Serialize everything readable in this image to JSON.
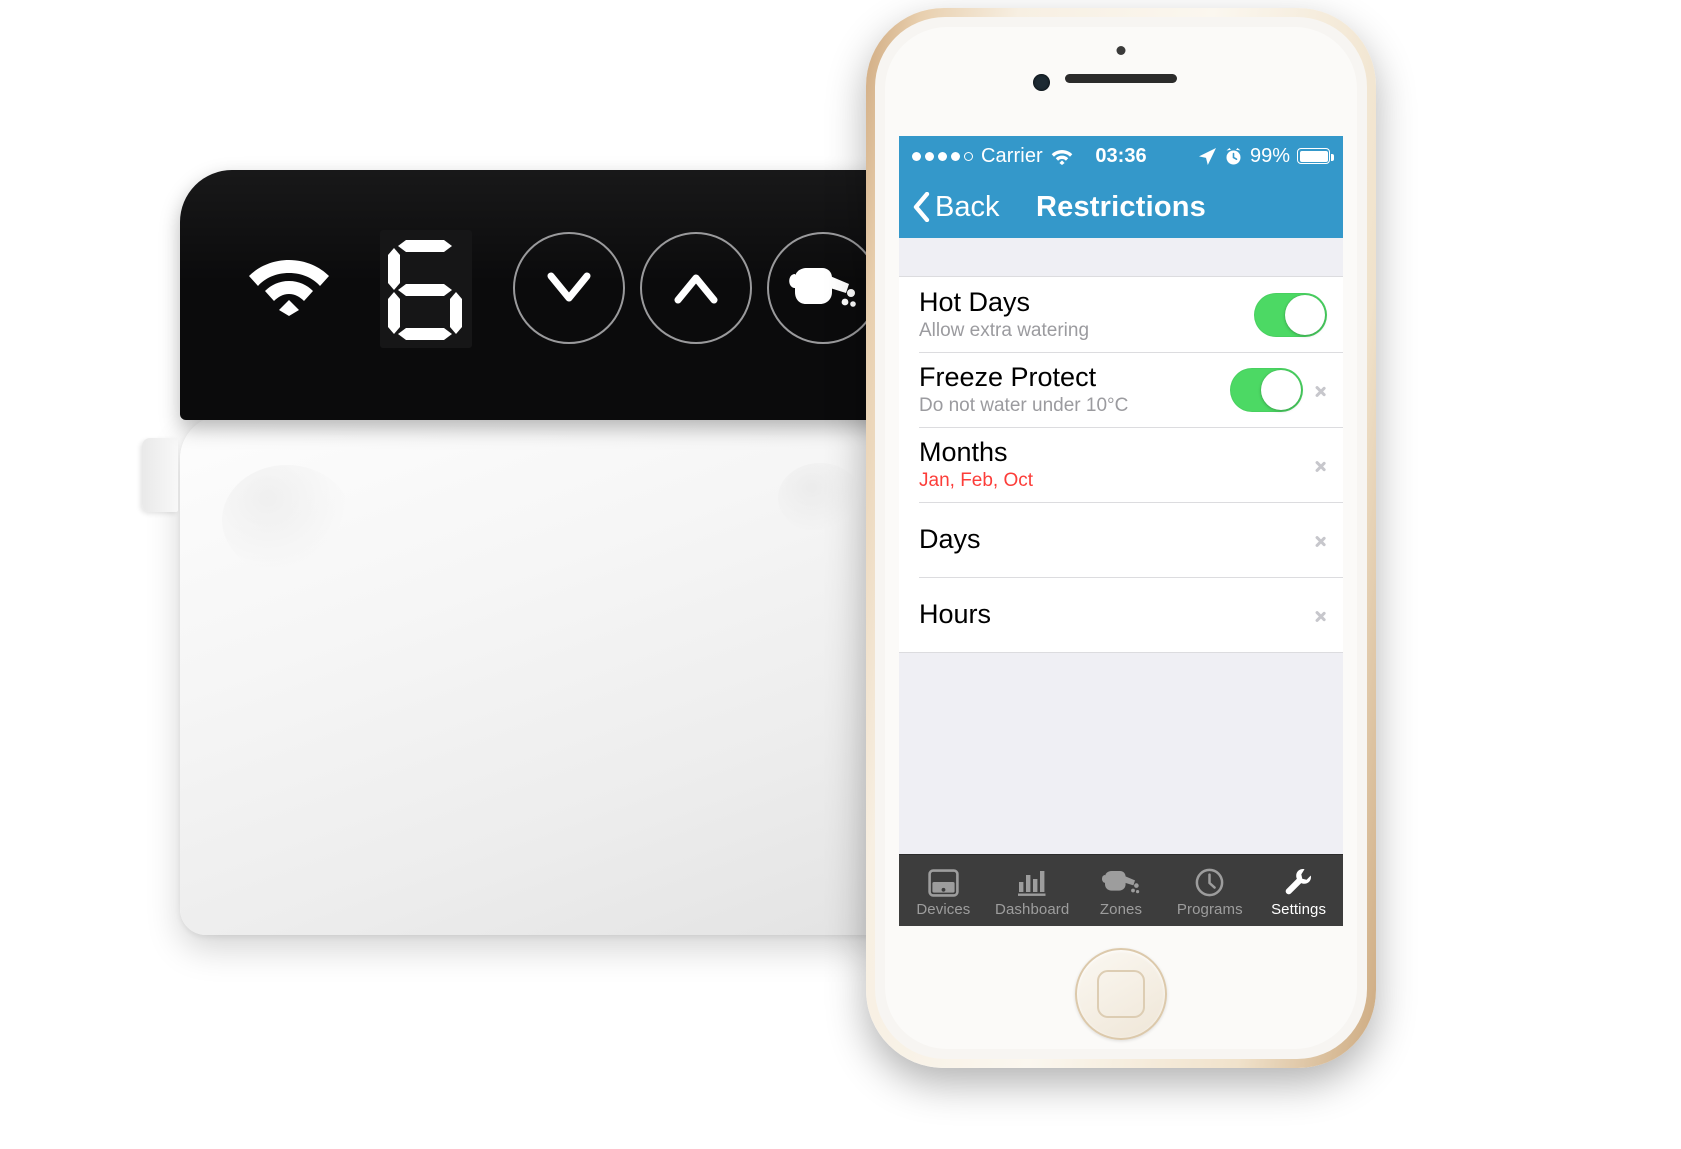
{
  "device": {
    "name": "wifi-irrigation-controller",
    "wifi_icon": "wifi-icon",
    "display_value": "6",
    "buttons": [
      {
        "name": "down-button",
        "icon": "chevron-down-icon"
      },
      {
        "name": "up-button",
        "icon": "chevron-up-icon"
      },
      {
        "name": "water-button",
        "icon": "watering-can-icon"
      }
    ]
  },
  "phone": {
    "status_bar": {
      "signal_dots_filled": 4,
      "signal_dots_total": 5,
      "carrier": "Carrier",
      "wifi_icon": "wifi-icon",
      "time": "03:36",
      "location_icon": "location-arrow-icon",
      "alarm_icon": "alarm-clock-icon",
      "battery_percent": "99%",
      "battery_level": 99
    },
    "nav_bar": {
      "back_label": "Back",
      "back_icon": "chevron-left-icon",
      "title": "Restrictions"
    },
    "rows": [
      {
        "name": "hot-days",
        "title": "Hot Days",
        "subtitle": "Allow extra watering",
        "subtitle_accent": false,
        "control": "toggle",
        "toggle_on": true,
        "chevron": false
      },
      {
        "name": "freeze-protect",
        "title": "Freeze Protect",
        "subtitle": "Do not water under 10°C",
        "subtitle_accent": false,
        "control": "toggle",
        "toggle_on": true,
        "chevron": true
      },
      {
        "name": "months",
        "title": "Months",
        "subtitle": "Jan, Feb, Oct",
        "subtitle_accent": true,
        "control": "none",
        "toggle_on": false,
        "chevron": true
      },
      {
        "name": "days",
        "title": "Days",
        "subtitle": "",
        "subtitle_accent": false,
        "control": "none",
        "toggle_on": false,
        "chevron": true
      },
      {
        "name": "hours",
        "title": "Hours",
        "subtitle": "",
        "subtitle_accent": false,
        "control": "none",
        "toggle_on": false,
        "chevron": true
      }
    ],
    "tabs": [
      {
        "name": "tab-devices",
        "label": "Devices",
        "icon": "device-screen-icon",
        "active": false
      },
      {
        "name": "tab-dashboard",
        "label": "Dashboard",
        "icon": "bar-chart-icon",
        "active": false
      },
      {
        "name": "tab-zones",
        "label": "Zones",
        "icon": "watering-can-icon",
        "active": false
      },
      {
        "name": "tab-programs",
        "label": "Programs",
        "icon": "clock-icon",
        "active": false
      },
      {
        "name": "tab-settings",
        "label": "Settings",
        "icon": "wrench-icon",
        "active": true
      }
    ]
  },
  "colors": {
    "nav_blue": "#3498ca",
    "toggle_green": "#4cd964",
    "accent_red": "#fc3d39",
    "tabbar_dark": "#3d3d3d",
    "content_gray": "#efeff4"
  }
}
